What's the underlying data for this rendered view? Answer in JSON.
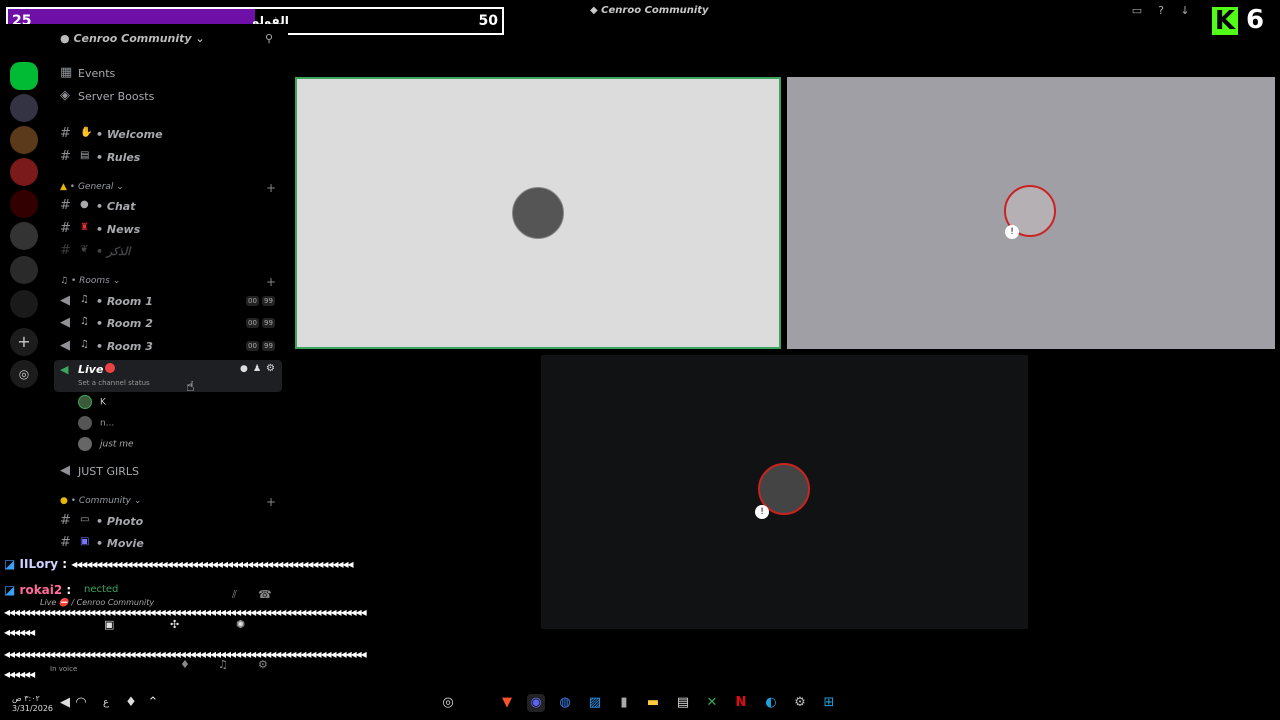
{
  "window": {
    "title": "Cenroo Community"
  },
  "overlay": {
    "follow_left": "25",
    "follow_label": "الفولو",
    "follow_right": "50",
    "follow_progress": 0.5,
    "brand_letter": "K",
    "brand_number": "6",
    "brand_color": "#53fc18",
    "bar_color": "#6e0fa8"
  },
  "server": {
    "name": "Cenroo Community"
  },
  "sidebar": {
    "top_items": [
      {
        "label": "Events",
        "icon": "calendar-icon"
      },
      {
        "label": "Server Boosts",
        "icon": "boost-icon"
      }
    ],
    "channels_top": [
      {
        "label": "Welcome"
      },
      {
        "label": "Rules"
      }
    ],
    "cat_general": "General",
    "channels_general": [
      {
        "label": "Chat"
      },
      {
        "label": "News"
      },
      {
        "label": "الذكر"
      }
    ],
    "cat_rooms": "Rooms",
    "rooms": [
      {
        "label": "Room 1",
        "count": "00",
        "limit": "99"
      },
      {
        "label": "Room 2",
        "count": "00",
        "limit": "99"
      },
      {
        "label": "Room 3",
        "count": "00",
        "limit": "99"
      }
    ],
    "live": {
      "label": "Live",
      "status_placeholder": "Set a channel status"
    },
    "live_users": [
      {
        "name": "K"
      },
      {
        "name": "n..."
      },
      {
        "name": "just me"
      }
    ],
    "just_girls": "JUST GIRLS",
    "cat_community": "Community",
    "channels_community": [
      {
        "label": "Photo"
      },
      {
        "label": "Movie"
      }
    ]
  },
  "voice_panel": {
    "status": "nected",
    "channel": "Live ⛔ / Cenroo Community",
    "in_voice": "In voice"
  },
  "chat": [
    {
      "user": "IILory",
      "sep": " : ",
      "text": "◂◂◂◂◂◂◂◂◂◂◂◂◂◂◂◂◂◂◂◂◂◂◂◂◂◂◂◂◂◂◂◂◂◂◂◂◂◂◂◂◂◂◂◂◂◂◂◂◂◂◂◂◂◂◂◂"
    },
    {
      "user": "rokai2",
      "sep": " : ",
      "text": ""
    }
  ],
  "spam_lines": [
    "◂◂◂◂◂◂◂◂◂◂◂◂◂◂◂◂◂◂◂◂◂◂◂◂◂◂◂◂◂◂◂◂◂◂◂◂◂◂◂◂◂◂◂◂◂◂◂◂◂◂◂◂◂◂◂◂◂◂◂◂◂◂◂◂◂◂◂◂◂◂◂◂",
    "◂◂◂◂◂◂",
    "◂◂◂◂◂◂◂◂◂◂◂◂◂◂◂◂◂◂◂◂◂◂◂◂◂◂◂◂◂◂◂◂◂◂◂◂◂◂◂◂◂◂◂◂◂◂◂◂◂◂◂◂◂◂◂◂◂◂◂◂◂◂◂◂◂◂◂◂◂◂◂◂",
    "◂◂◂◂◂◂"
  ],
  "taskbar": {
    "time": "٣:٠٢ ص",
    "date": "3/31/2026",
    "lang": "ع"
  }
}
